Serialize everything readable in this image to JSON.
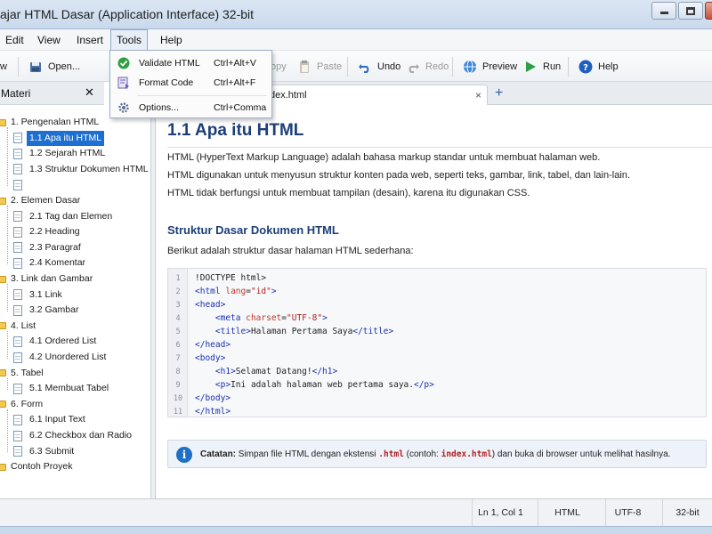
{
  "window": {
    "title": "ajar HTML Dasar (Application Interface) 32-bit"
  },
  "menubar": {
    "items": [
      "Edit",
      "View",
      "Insert",
      "Tools",
      "Help"
    ]
  },
  "tools_menu": {
    "items": [
      {
        "label": "Validate HTML",
        "shortcut": "Ctrl+Alt+V",
        "icon": "check-icon"
      },
      {
        "label": "Format Code",
        "shortcut": "Ctrl+Alt+F",
        "icon": "format-icon"
      },
      {
        "label": "Options...",
        "shortcut": "Ctrl+Comma",
        "icon": "gear-icon"
      }
    ]
  },
  "toolbar": {
    "new_label": "w",
    "open_label": "Open...",
    "copy_label": "opy",
    "paste_label": "Paste",
    "undo_label": "Undo",
    "redo_label": "Redo",
    "preview_label": "Preview",
    "run_label": "Run",
    "help_label": "Help"
  },
  "sidebar": {
    "title": "Materi",
    "close_glyph": "✕",
    "sections": [
      {
        "label": "1. Pengenalan HTML",
        "items": [
          "1.1 Apa itu HTML",
          "1.2 Sejarah HTML",
          "1.3 Struktur Dokumen HTML",
          ""
        ]
      },
      {
        "label": "2. Elemen Dasar",
        "items": [
          "2.1 Tag dan Elemen",
          "2.2 Heading",
          "2.3 Paragraf",
          "2.4 Komentar"
        ]
      },
      {
        "label": "3. Link dan Gambar",
        "items": [
          "3.1 Link",
          "3.2 Gambar"
        ]
      },
      {
        "label": "4. List",
        "items": [
          "4.1 Ordered List",
          "4.2 Unordered List"
        ]
      },
      {
        "label": "5. Tabel",
        "items": [
          "5.1 Membuat Tabel"
        ]
      },
      {
        "label": "6. Form",
        "items": [
          "6.1 Input Text",
          "6.2 Checkbox dan Radio",
          "6.3 Submit"
        ]
      },
      {
        "label": "Contoh Proyek",
        "items": []
      }
    ],
    "selected_item": "1.1 Apa itu HTML"
  },
  "tabs": {
    "active_label": "dex.html",
    "close_glyph": "×",
    "add_glyph": "+"
  },
  "content": {
    "heading": "1.1 Apa itu HTML",
    "paragraphs": [
      "HTML (HyperText Markup Language) adalah bahasa markup standar untuk membuat halaman web.",
      "HTML digunakan untuk menyusun struktur konten pada web, seperti teks, gambar, link, tabel, dan lain-lain.",
      "HTML tidak berfungsi untuk membuat tampilan (desain), karena itu digunakan CSS."
    ],
    "subheading": "Struktur Dasar Dokumen HTML",
    "intro": "Berikut adalah struktur dasar halaman HTML sederhana:",
    "code_lines": [
      "<!DOCTYPE html>",
      "<html lang=\"id\">",
      "<head>",
      "    <meta charset=\"UTF-8\">",
      "    <title>Halaman Pertama Saya</title>",
      "</head>",
      "<body>",
      "    <h1>Selamat Datang!</h1>",
      "    <p>Ini adalah halaman web pertama saya.</p>",
      "</body>",
      "</html>"
    ],
    "note": {
      "icon_glyph": "i",
      "label": "Catatan:",
      "text_before": " Simpan file HTML dengan ekstensi ",
      "ext": ".html",
      "text_mid": " (contoh: ",
      "example": "index.html",
      "text_after": ") dan buka di browser untuk melihat hasilnya."
    }
  },
  "statusbar": {
    "position": "Ln 1, Col 1",
    "language": "HTML",
    "encoding": "UTF-8",
    "arch": "32-bit"
  },
  "colors": {
    "accent": "#1c3f78",
    "selection": "#1e6fd0",
    "tag": "#1a2fb0",
    "attr": "#c0392b"
  }
}
